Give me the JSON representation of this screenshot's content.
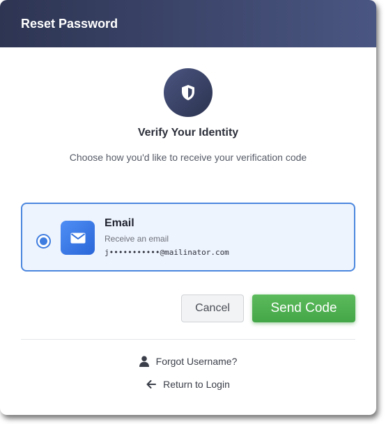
{
  "header": {
    "title": "Reset Password"
  },
  "verify": {
    "icon": "shield-icon",
    "heading": "Verify Your Identity",
    "subtitle": "Choose how you'd like to receive your verification code"
  },
  "option": {
    "selected": true,
    "icon": "mail-icon",
    "title": "Email",
    "description": "Receive an email",
    "email": "j•••••••••••@mailinator.com"
  },
  "buttons": {
    "cancel_label": "Cancel",
    "send_label": "Send Code"
  },
  "links": {
    "forgot_username": "Forgot Username?",
    "forgot_icon": "user-icon",
    "return_to_login": "Return to Login",
    "return_icon": "arrow-left-icon"
  },
  "colors": {
    "header_start": "#2e3553",
    "header_end": "#4a5682",
    "accent_blue": "#3f7de0",
    "send_green": "#4cae4f"
  }
}
